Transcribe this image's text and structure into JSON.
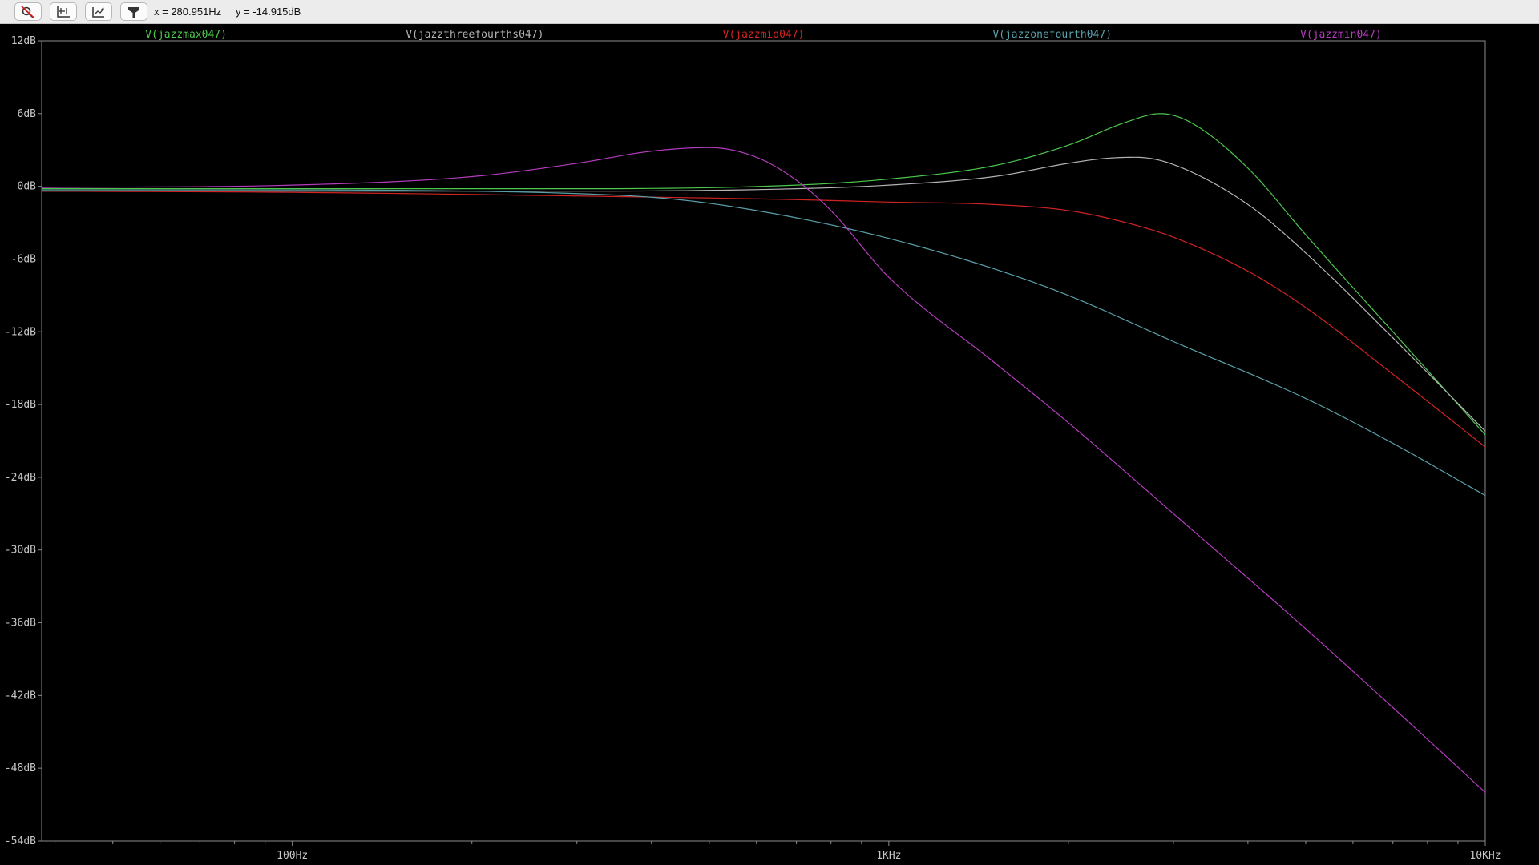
{
  "toolbar": {
    "buttons": [
      {
        "icon": "zoom-cancel-icon"
      },
      {
        "icon": "autorange-icon"
      },
      {
        "icon": "zoom-back-icon"
      },
      {
        "icon": "cursor-probe-icon"
      }
    ],
    "x_readout": "x = 280.951Hz",
    "y_readout": "y = -14.915dB"
  },
  "colors": {
    "background": "#000000",
    "axis": "#8c8c8c",
    "tick_label": "#c8c8c8"
  },
  "chart_data": {
    "type": "line",
    "title": "",
    "xlabel": "",
    "ylabel": "",
    "x_scale": "log",
    "xlim": [
      38,
      10000
    ],
    "ylim": [
      -54,
      12
    ],
    "grid": false,
    "legend": "top",
    "x_ticks": [
      {
        "value": 100,
        "label": "100Hz"
      },
      {
        "value": 1000,
        "label": "1KHz"
      },
      {
        "value": 10000,
        "label": "10KHz"
      }
    ],
    "y_ticks": [
      {
        "value": 12,
        "label": "12dB"
      },
      {
        "value": 6,
        "label": "6dB"
      },
      {
        "value": 0,
        "label": "0dB"
      },
      {
        "value": -6,
        "label": "-6dB"
      },
      {
        "value": -12,
        "label": "-12dB"
      },
      {
        "value": -18,
        "label": "-18dB"
      },
      {
        "value": -24,
        "label": "-24dB"
      },
      {
        "value": -30,
        "label": "-30dB"
      },
      {
        "value": -36,
        "label": "-36dB"
      },
      {
        "value": -42,
        "label": "-42dB"
      },
      {
        "value": -48,
        "label": "-48dB"
      },
      {
        "value": -54,
        "label": "-54dB"
      }
    ],
    "series": [
      {
        "name": "V(jazzmax047)",
        "color": "#4cc84c",
        "x": [
          38,
          100,
          300,
          700,
          1000,
          1500,
          2000,
          2500,
          2850,
          3200,
          4000,
          5000,
          7000,
          10000
        ],
        "y": [
          -0.2,
          -0.2,
          -0.2,
          0.1,
          0.6,
          1.7,
          3.4,
          5.3,
          6.0,
          5.3,
          1.5,
          -4.0,
          -12.0,
          -20.5
        ]
      },
      {
        "name": "V(jazzthreefourths047)",
        "color": "#b4b4b4",
        "x": [
          38,
          100,
          300,
          700,
          1000,
          1500,
          2000,
          2300,
          2600,
          3000,
          4000,
          5000,
          7000,
          10000
        ],
        "y": [
          -0.4,
          -0.4,
          -0.4,
          -0.2,
          0.1,
          0.8,
          1.9,
          2.3,
          2.4,
          1.8,
          -1.5,
          -5.5,
          -12.5,
          -20.2
        ]
      },
      {
        "name": "V(jazzmid047)",
        "color": "#d22323",
        "x": [
          38,
          100,
          300,
          700,
          1000,
          1500,
          2000,
          2500,
          3000,
          4000,
          5000,
          7000,
          10000
        ],
        "y": [
          -0.4,
          -0.5,
          -0.8,
          -1.1,
          -1.3,
          -1.5,
          -2.0,
          -3.0,
          -4.2,
          -7.0,
          -10.0,
          -15.5,
          -21.5
        ]
      },
      {
        "name": "V(jazzonefourth047)",
        "color": "#5aa0aa",
        "x": [
          38,
          100,
          200,
          300,
          400,
          500,
          700,
          1000,
          1500,
          2000,
          3000,
          5000,
          7000,
          10000
        ],
        "y": [
          -0.3,
          -0.3,
          -0.4,
          -0.6,
          -0.9,
          -1.4,
          -2.6,
          -4.3,
          -6.8,
          -9.0,
          -12.8,
          -17.5,
          -21.2,
          -25.5
        ]
      },
      {
        "name": "V(jazzmin047)",
        "color": "#b43cbe",
        "x": [
          38,
          100,
          200,
          300,
          400,
          500,
          600,
          700,
          800,
          1000,
          1500,
          2000,
          3000,
          5000,
          7000,
          10000
        ],
        "y": [
          -0.1,
          0.1,
          0.8,
          1.9,
          2.9,
          3.2,
          2.4,
          0.5,
          -2.0,
          -7.5,
          -14.5,
          -19.5,
          -27.0,
          -36.5,
          -43.0,
          -50.0
        ]
      }
    ]
  }
}
